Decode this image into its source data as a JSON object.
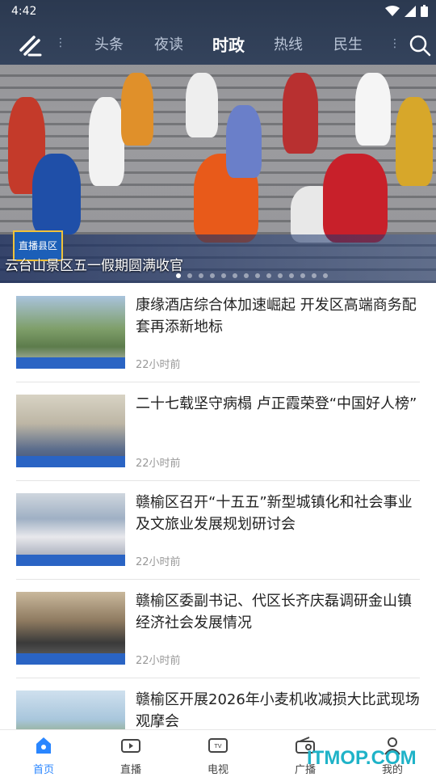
{
  "status": {
    "time": "4:42"
  },
  "nav": {
    "tabs": [
      "头条",
      "夜读",
      "时政",
      "热线",
      "民生"
    ],
    "active_tab": "时政"
  },
  "hero": {
    "badge": "直播县区",
    "title": "云台山景区五一假期圆满收官",
    "slide_count": 14,
    "active_slide": 1
  },
  "news": [
    {
      "title": "康缘酒店综合体加速崛起 开发区高端商务配套再添新地标",
      "time": "22小时前"
    },
    {
      "title": "二十七载坚守病榻 卢正霞荣登“中国好人榜”",
      "time": "22小时前"
    },
    {
      "title": "赣榆区召开“十五五”新型城镇化和社会事业及文旅业发展规划研讨会",
      "time": "22小时前"
    },
    {
      "title": "赣榆区委副书记、代区长齐庆磊调研金山镇经济社会发展情况",
      "time": "22小时前"
    },
    {
      "title": "赣榆区开展2026年小麦机收减损大比武现场观摩会",
      "time": ""
    }
  ],
  "bottom_nav": [
    {
      "label": "首页",
      "icon": "home-icon",
      "active": true
    },
    {
      "label": "直播",
      "icon": "video-icon",
      "active": false
    },
    {
      "label": "电视",
      "icon": "tv-icon",
      "active": false
    },
    {
      "label": "广播",
      "icon": "radio-icon",
      "active": false
    },
    {
      "label": "我的",
      "icon": "user-icon",
      "active": false
    }
  ],
  "watermark": "ITMOP.COM",
  "colors": {
    "accent": "#2a86ff",
    "header": "#2b3950"
  }
}
